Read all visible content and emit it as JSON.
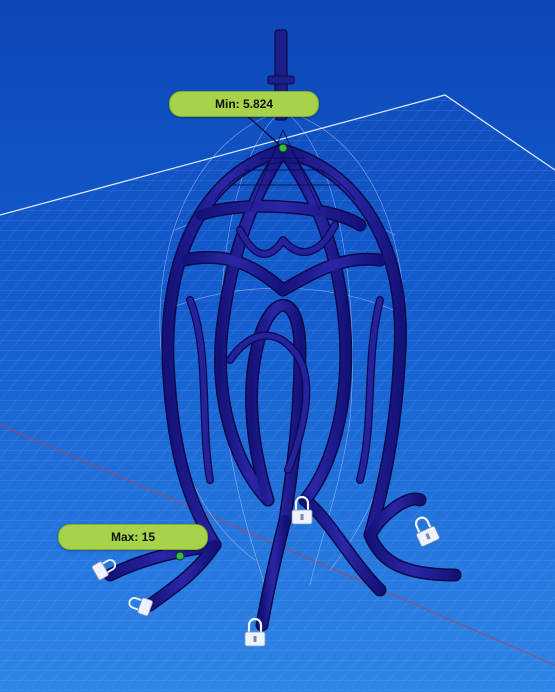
{
  "annotations": {
    "min_label": "Min: 5.824",
    "max_label": "Max: 15"
  },
  "colors": {
    "background_top": "#0d47b8",
    "background_bottom": "#2f86e6",
    "grid_line": "#8fb8ff",
    "lattice_fill": "#1f1c8f",
    "lattice_outline": "#0b0a4a",
    "callout_fill": "#a6d34a",
    "marker_green": "#35b84a",
    "axis_red": "#c23b4a"
  },
  "icons": {
    "anchor": "lock-icon"
  }
}
